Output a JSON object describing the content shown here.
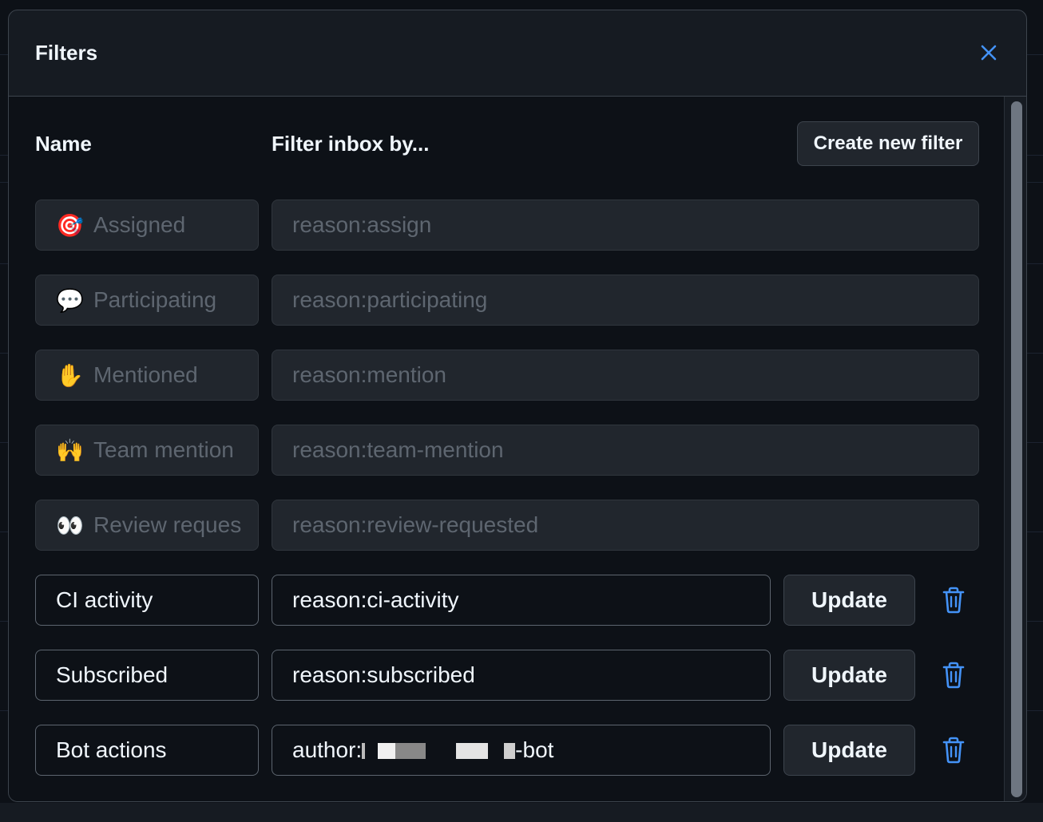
{
  "modal": {
    "title": "Filters",
    "close_icon": "close-icon"
  },
  "columns": {
    "name": "Name",
    "filter": "Filter inbox by..."
  },
  "create_button": "Create new filter",
  "default_filters": [
    {
      "emoji": "🎯",
      "icon": "dart-target-icon",
      "name": "Assigned",
      "query": "reason:assign"
    },
    {
      "emoji": "💬",
      "icon": "speech-bubble-icon",
      "name": "Participating",
      "query": "reason:participating"
    },
    {
      "emoji": "✋",
      "icon": "raised-hand-icon",
      "name": "Mentioned",
      "query": "reason:mention"
    },
    {
      "emoji": "🙌",
      "icon": "raising-hands-icon",
      "name": "Team mention",
      "query": "reason:team-mention"
    },
    {
      "emoji": "👀",
      "icon": "eyes-icon",
      "name": "Review reques",
      "query": "reason:review-requested"
    }
  ],
  "custom_filters": [
    {
      "name": "CI activity",
      "query": "reason:ci-activity",
      "update_label": "Update",
      "delete_icon": "trash-icon"
    },
    {
      "name": "Subscribed",
      "query": "reason:subscribed",
      "update_label": "Update",
      "delete_icon": "trash-icon"
    },
    {
      "name": "Bot actions",
      "query_prefix": "author:",
      "query_suffix": "-bot",
      "query_redacted": true,
      "update_label": "Update",
      "delete_icon": "trash-icon"
    }
  ],
  "colors": {
    "accent_blue": "#4493f8",
    "modal_bg": "#161b22",
    "body_bg": "#0d1117",
    "text": "#f0f6fc",
    "muted_text": "#5e6670"
  }
}
